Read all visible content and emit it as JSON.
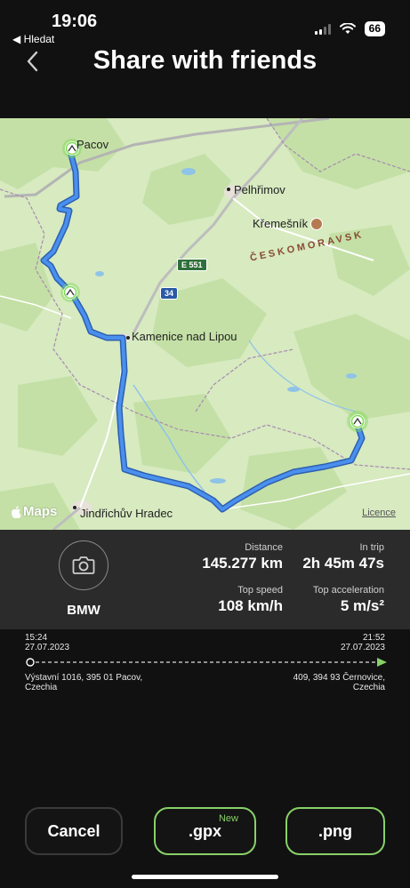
{
  "status_bar": {
    "time": "19:06",
    "back_app": "◀ Hledat",
    "battery": "66"
  },
  "header": {
    "title": "Share with friends"
  },
  "map": {
    "places": {
      "pacov": "Pacov",
      "pelhrimov": "Pelhřimov",
      "kremesnik": "Křemešník",
      "kamenice": "Kamenice nad Lipou",
      "jindrichuv": "Jindřichův Hradec",
      "region": "ČESKOMORAVSK"
    },
    "road_e": "E 551",
    "road_34": "34",
    "attribution": "Maps",
    "licence": "Licence",
    "route_color": "#3a7be0",
    "marker_color": "#7ed957",
    "land_color": "#d7eac0"
  },
  "trip": {
    "car_name": "BMW",
    "distance_label": "Distance",
    "distance_value": "145.277 km",
    "in_trip_label": "In trip",
    "in_trip_value": "2h 45m 47s",
    "top_speed_label": "Top speed",
    "top_speed_value": "108 km/h",
    "top_accel_label": "Top acceleration",
    "top_accel_value": "5 m/s²"
  },
  "timeline": {
    "start_time": "15:24",
    "start_date": "27.07.2023",
    "start_address_1": "Výstavní 1016, 395 01 Pacov,",
    "start_address_2": "Czechia",
    "end_time": "21:52",
    "end_date": "27.07.2023",
    "end_address_1": "409, 394 93 Černovice,",
    "end_address_2": "Czechia",
    "accent_color": "#88d168"
  },
  "actions": {
    "cancel": "Cancel",
    "gpx": ".gpx",
    "gpx_badge": "New",
    "png": ".png"
  }
}
